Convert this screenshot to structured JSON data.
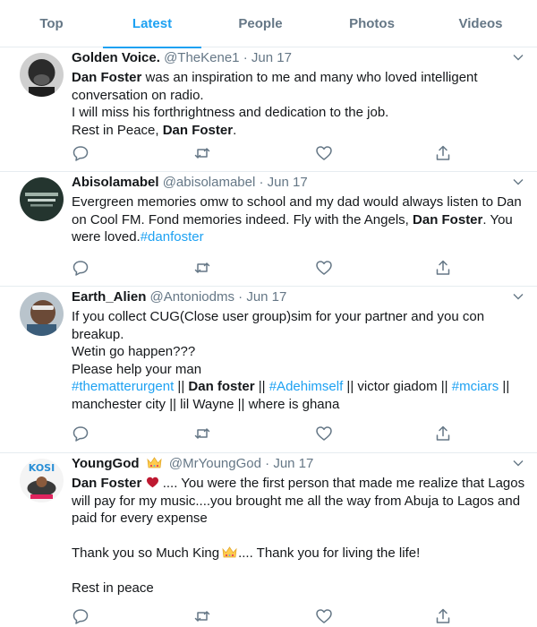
{
  "tabs": [
    "Top",
    "Latest",
    "People",
    "Photos",
    "Videos"
  ],
  "active_tab": "Latest",
  "colors": {
    "accent": "#1da1f2",
    "secondary_text": "#657786",
    "border": "#e6ecf0",
    "heart": "#e0245e",
    "crown": "#ffcc4d"
  },
  "separator": "·",
  "tweets": [
    {
      "name": "Golden Voice.",
      "handle": "@TheKene1",
      "date": "Jun 17",
      "lines": [
        [
          "Dan Foster",
          " was an inspiration to me and many who loved intelligent"
        ],
        "conversation on radio.",
        "I will miss his forthrightness and dedication to the job.",
        [
          "Rest in Peace, ",
          "Dan Foster",
          "."
        ]
      ]
    },
    {
      "name": "Abisolamabel",
      "handle": "@abisolamabel",
      "date": "Jun 17",
      "lines": [
        "Evergreen memories omw to school and my dad would always listen to Dan",
        [
          "on Cool FM. Fond memories indeed. Fly with the Angels, ",
          "Dan Foster",
          ". You"
        ],
        [
          "were loved.",
          "#danfoster"
        ]
      ]
    },
    {
      "name": "Earth_Alien",
      "handle": "@Antoniodms",
      "date": "Jun 17",
      "lines": [
        "If you collect CUG(Close user group)sim for your partner and you con",
        "breakup.",
        "Wetin go happen???",
        "Please help your man",
        [
          "#thematterurgent",
          " || ",
          "Dan foster",
          " || ",
          "#Adehimself",
          " || victor giadom || ",
          "#mciars",
          " ||"
        ],
        "manchester city || lil Wayne || where is ghana"
      ]
    },
    {
      "name": "YoungGod",
      "handle": "@MrYoungGod",
      "date": "Jun 17",
      "avatar_text": "KOSI",
      "lines": [
        [
          "Dan Foster",
          " .... You were the first person that made me realize that Lagos"
        ],
        "will pay for my  music....you brought me all the way from Abuja to Lagos and",
        "paid for every expense",
        "",
        [
          "Thank you so Much King",
          ".... Thank you for living the life!"
        ],
        "",
        "Rest in peace"
      ]
    }
  ]
}
